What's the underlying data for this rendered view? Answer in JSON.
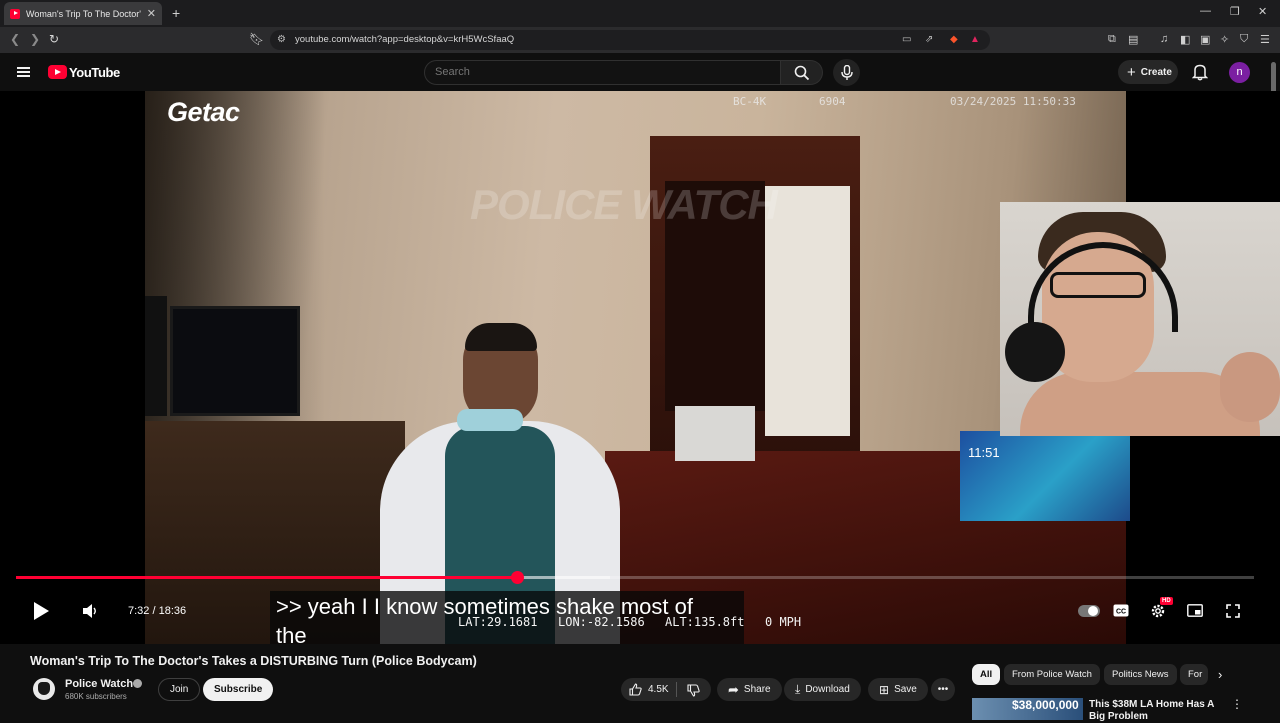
{
  "browser": {
    "tab_title": "Woman's Trip To The Doctor's Takes a DISTURBING Turn (Police Bodycam)",
    "url": "youtube.com/watch?app=desktop&v=krH5WcSfaaQ",
    "new_tab_label": "+"
  },
  "header": {
    "logo_text": "YouTube",
    "search_placeholder": "Search",
    "create_label": "Create",
    "avatar_letter": "n"
  },
  "player": {
    "brand_text": "Getac",
    "osd_device": "BC-4K",
    "osd_id": "6904",
    "osd_datetime": "03/24/2025 11:50:33",
    "watermark": "POLICE WATCH",
    "gps_lat": "LAT:29.1681",
    "gps_lon": "LON:-82.1586",
    "gps_alt": "ALT:135.8ft",
    "gps_speed": "0 MPH",
    "caption_line1": ">> yeah I I know sometimes shake most of",
    "caption_line2": "the",
    "current_time": "7:32",
    "duration": "18:36",
    "time_display": "7:32 / 18:36",
    "played_fraction": 0.405,
    "buffered_fraction": 0.48,
    "quality_badge": "HD",
    "monitor_clock": "11:51"
  },
  "video": {
    "title": "Woman's Trip To The Doctor's Takes a DISTURBING Turn (Police Bodycam)",
    "channel_name": "Police Watch",
    "subscribers": "680K subscribers",
    "join_label": "Join",
    "subscribe_label": "Subscribe",
    "likes": "4.5K",
    "share_label": "Share",
    "download_label": "Download",
    "save_label": "Save"
  },
  "recommendations": {
    "chips": [
      "All",
      "From Police Watch",
      "Politics News",
      "For"
    ],
    "items": [
      {
        "thumb_text": "$38,000,000",
        "title": "This $38M LA Home Has A Big Problem"
      }
    ]
  },
  "colors": {
    "accent": "#ff0033",
    "background": "#0f0f0f",
    "chip_bg": "#272727"
  },
  "icons": [
    "hamburger-icon",
    "search-icon",
    "mic-icon",
    "bell-icon",
    "play-icon",
    "volume-icon",
    "cc-icon",
    "settings-icon",
    "miniplayer-icon",
    "fullscreen-icon",
    "like-icon",
    "dislike-icon",
    "share-icon",
    "download-icon",
    "save-icon",
    "more-icon",
    "chevron-right-icon"
  ]
}
